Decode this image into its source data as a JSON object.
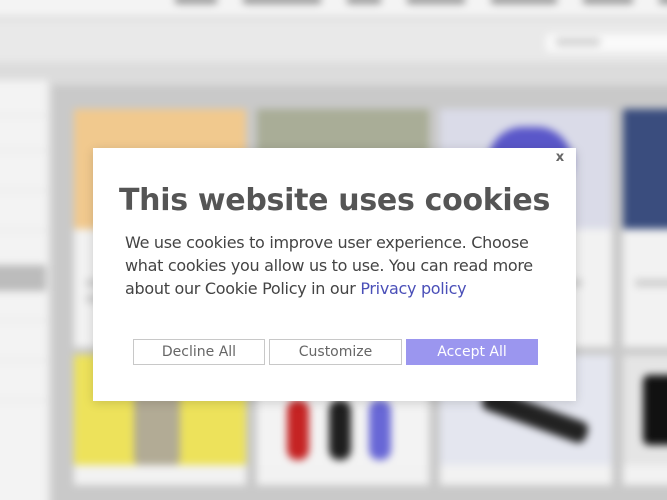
{
  "modal": {
    "close": "x",
    "title": "This website uses cookies",
    "body": "We use cookies to improve user experience. Choose what cookies you allow us to use. You can read more about our Cookie Policy in our",
    "link": "Privacy policy"
  },
  "buttons": {
    "decline": "Decline All",
    "customize": "Customize",
    "accept": "Accept All"
  },
  "colors": {
    "accent": "#9b96ef",
    "link": "#4a4fb8",
    "title": "#555555"
  }
}
